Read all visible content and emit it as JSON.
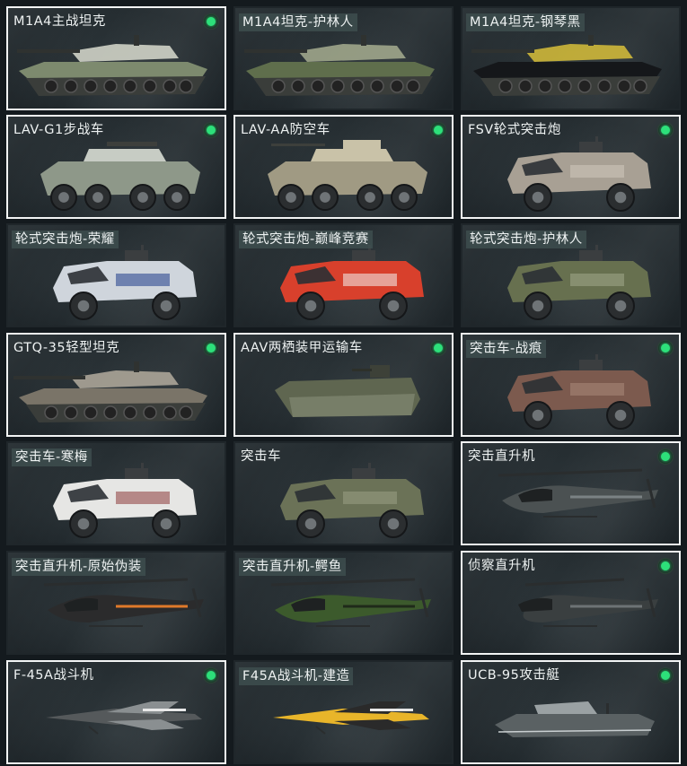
{
  "indicator_color": "#2de07a",
  "vehicles": [
    {
      "name": "M1A4主战坦克",
      "owned": true,
      "skin": false,
      "icon": "tank-icon",
      "body": "#7d8a6e",
      "accent": "#d9dccf"
    },
    {
      "name": "M1A4坦克-护林人",
      "owned": false,
      "skin": true,
      "icon": "tank-icon",
      "body": "#5f6e4c",
      "accent": "#a6ad8f"
    },
    {
      "name": "M1A4坦克-钢琴黑",
      "owned": false,
      "skin": true,
      "icon": "tank-icon",
      "body": "#15171a",
      "accent": "#d8c03a"
    },
    {
      "name": "LAV-G1步战车",
      "owned": true,
      "skin": false,
      "icon": "ifv-icon",
      "body": "#8e9889",
      "accent": "#c7ccc4"
    },
    {
      "name": "LAV-AA防空车",
      "owned": true,
      "skin": false,
      "icon": "anti-air-vehicle-icon",
      "body": "#a09a83",
      "accent": "#c9c2a8"
    },
    {
      "name": "FSV轮式突击炮",
      "owned": true,
      "skin": false,
      "icon": "assault-gun-icon",
      "body": "#a8a094",
      "accent": "#cfc8bc"
    },
    {
      "name": "轮式突击炮-荣耀",
      "owned": false,
      "skin": true,
      "icon": "assault-gun-icon",
      "body": "#cfd5dc",
      "accent": "#1f3d8a"
    },
    {
      "name": "轮式突击炮-巅峰竞赛",
      "owned": false,
      "skin": true,
      "icon": "assault-gun-icon",
      "body": "#d8402c",
      "accent": "#f2f2f2"
    },
    {
      "name": "轮式突击炮-护林人",
      "owned": false,
      "skin": true,
      "icon": "assault-gun-icon",
      "body": "#67704f",
      "accent": "#a3a98c"
    },
    {
      "name": "GTQ-35轻型坦克",
      "owned": true,
      "skin": false,
      "icon": "light-tank-icon",
      "body": "#7a7468",
      "accent": "#b3ab9d"
    },
    {
      "name": "AAV两栖装甲运输车",
      "owned": true,
      "skin": false,
      "icon": "amphibious-vehicle-icon",
      "body": "#5f6650",
      "accent": "#8f9580"
    },
    {
      "name": "突击车-战痕",
      "owned": true,
      "skin": true,
      "icon": "assault-vehicle-icon",
      "body": "#7c5a4e",
      "accent": "#a98a7a"
    },
    {
      "name": "突击车-寒梅",
      "owned": false,
      "skin": true,
      "icon": "assault-vehicle-icon",
      "body": "#e6e6e4",
      "accent": "#8c3b3b"
    },
    {
      "name": "突击车",
      "owned": false,
      "skin": false,
      "icon": "assault-vehicle-icon",
      "body": "#6b7257",
      "accent": "#9aa085"
    },
    {
      "name": "突击直升机",
      "owned": true,
      "skin": false,
      "icon": "attack-helicopter-icon",
      "body": "#4b5152",
      "accent": "#7b8284"
    },
    {
      "name": "突击直升机-原始伪装",
      "owned": false,
      "skin": true,
      "icon": "attack-helicopter-icon",
      "body": "#2b2b2c",
      "accent": "#e07a2a"
    },
    {
      "name": "突击直升机-鳄鱼",
      "owned": false,
      "skin": true,
      "icon": "attack-helicopter-icon",
      "body": "#3c5a2c",
      "accent": "#1f2a1a"
    },
    {
      "name": "侦察直升机",
      "owned": true,
      "skin": false,
      "icon": "scout-helicopter-icon",
      "body": "#3a3f40",
      "accent": "#6d7375"
    },
    {
      "name": "F-45A战斗机",
      "owned": true,
      "skin": false,
      "icon": "fighter-jet-icon",
      "body": "#55595b",
      "accent": "#8a8f91"
    },
    {
      "name": "F45A战斗机-建造",
      "owned": false,
      "skin": true,
      "icon": "fighter-jet-icon",
      "body": "#e8b52a",
      "accent": "#2a2a2a"
    },
    {
      "name": "UCB-95攻击艇",
      "owned": true,
      "skin": false,
      "icon": "attack-boat-icon",
      "body": "#5a6163",
      "accent": "#9aa1a3"
    }
  ]
}
